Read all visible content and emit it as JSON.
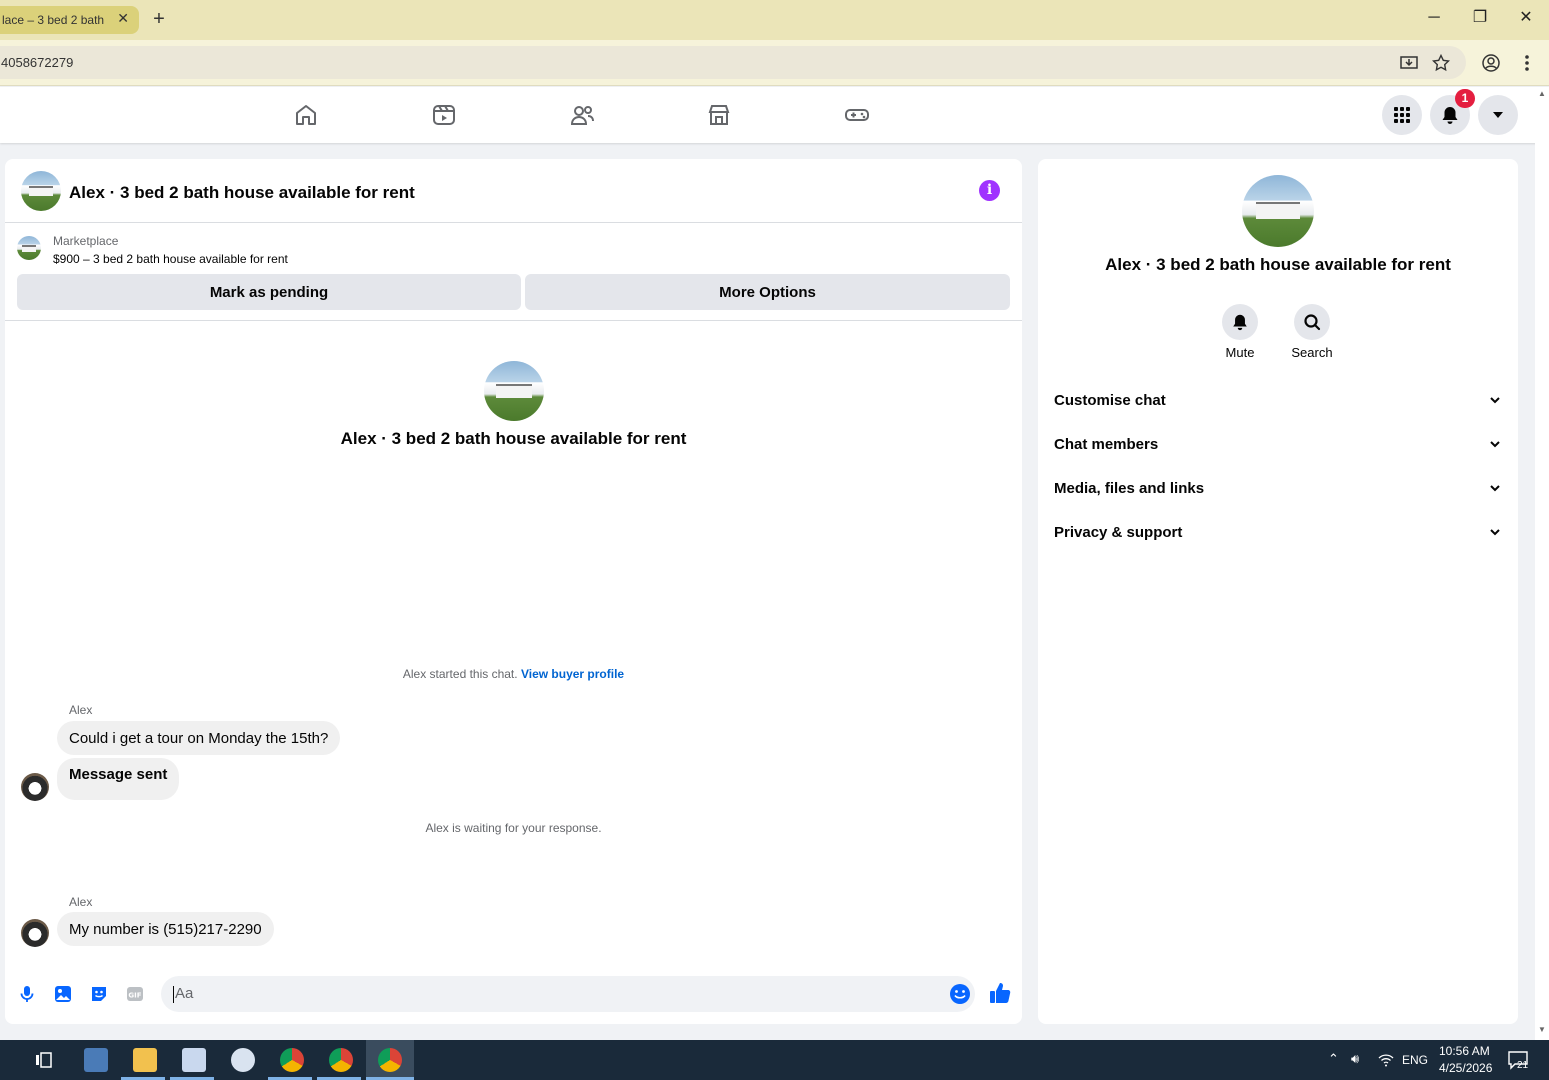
{
  "browser": {
    "tab_title": "lace – 3 bed 2 bath",
    "tab_close": "✕",
    "new_tab": "+",
    "url": "4058672279"
  },
  "window": {
    "minimize": "─",
    "maximize": "❐",
    "close": "✕"
  },
  "fb_nav": {
    "icons": [
      "home-icon",
      "video-icon",
      "friends-icon",
      "marketplace-icon",
      "gaming-icon"
    ],
    "notification_count": "1"
  },
  "chat": {
    "title": "Alex · 3 bed 2 bath house available for rent",
    "info_glyph": "i",
    "marketplace_label": "Marketplace",
    "listing": "$900 – 3 bed 2 bath house available for rent",
    "mark_pending": "Mark as pending",
    "more_options": "More Options",
    "center_name": "Alex · 3 bed 2 bath house available for rent",
    "started_text": "Alex started this chat.",
    "view_buyer_profile": "View buyer profile",
    "messages": [
      {
        "sender": "Alex",
        "text": "Could i get a tour on Monday the 15th?"
      },
      {
        "text": "Message sent"
      },
      {
        "sender": "Alex",
        "text": "My number is (515)217-2290"
      }
    ],
    "waiting_text": "Alex is waiting for your response.",
    "composer_placeholder": "Aa"
  },
  "info_panel": {
    "name": "Alex · 3 bed 2 bath house available for rent",
    "mute_label": "Mute",
    "search_label": "Search",
    "sections": [
      "Customise chat",
      "Chat members",
      "Media, files and links",
      "Privacy & support"
    ]
  },
  "taskbar": {
    "language": "ENG",
    "time": "10:56 AM",
    "date": "4/25/2026",
    "notification_count": "21"
  },
  "colors": {
    "accent_blue": "#0866ff",
    "info_purple": "#a033ff",
    "badge_red": "#e41e3f",
    "tab_yellow": "#dbd17a"
  }
}
